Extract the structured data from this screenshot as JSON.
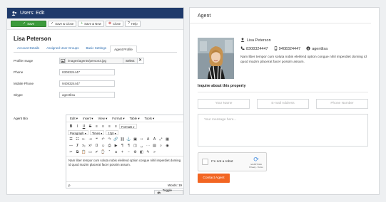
{
  "admin": {
    "window_title": "Users: Edit",
    "toolbar": {
      "save": "Save",
      "save_close": "Save & Close",
      "save_new": "Save & New",
      "close": "Close",
      "help": "Help"
    },
    "user_name": "Lisa Peterson",
    "tabs": [
      "Account Details",
      "Assigned User Groups",
      "Basic Settings",
      "Agent Profile"
    ],
    "active_tab": "Agent Profile",
    "fields": {
      "profile_image": {
        "label": "Profile Image",
        "value": "images/agents/person3.jpg",
        "select": "Select",
        "clear": "✕"
      },
      "phone": {
        "label": "Phone",
        "value": "8308324447"
      },
      "mobile": {
        "label": "Mobile Phone",
        "value": "9408324447"
      },
      "skype": {
        "label": "Skype",
        "value": "agentlisa"
      },
      "bio_label": "Agent Bio"
    },
    "editor": {
      "menu": [
        "Edit ▾",
        "Insert ▾",
        "View ▾",
        "Format ▾",
        "Table ▾",
        "Tools ▾"
      ],
      "formats_select": "Formats ▾",
      "paragraph_select": "Paragraph ▾",
      "font_select": "Times ▾",
      "size_select": "12pt ▾",
      "content": "Nam liber tempor cum soluta nobis eleifend option congue nihil imperdiet doming id quod mazim placerat facer possim assum.",
      "status_path": "p",
      "word_count": "Words: 19",
      "toggle_label": "Toggle editor"
    }
  },
  "agent": {
    "heading": "Agent",
    "name": "Lisa Peterson",
    "phone": "8308324447",
    "mobile": "9408324447",
    "skype": "agentlisa",
    "bio": "Nam liber tempor cum soluta nobis eleifend option congue nihil imperdiet doming id quod mazim placerat facer possim assum.",
    "inquire_heading": "Inquire about this property",
    "placeholders": {
      "name": "Your Name",
      "email": "E-mail Address",
      "phone": "Phone Number",
      "message": "Your message here..."
    },
    "captcha": {
      "label": "I'm not a robot",
      "brand": "reCAPTCHA",
      "links": "Privacy - Terms"
    },
    "contact_button": "Contact Agent"
  },
  "colors": {
    "titlebar": "#1f3a6b",
    "save_button": "#3c9b3c",
    "contact_button": "#f26522",
    "tab_link": "#2a6cb0"
  }
}
